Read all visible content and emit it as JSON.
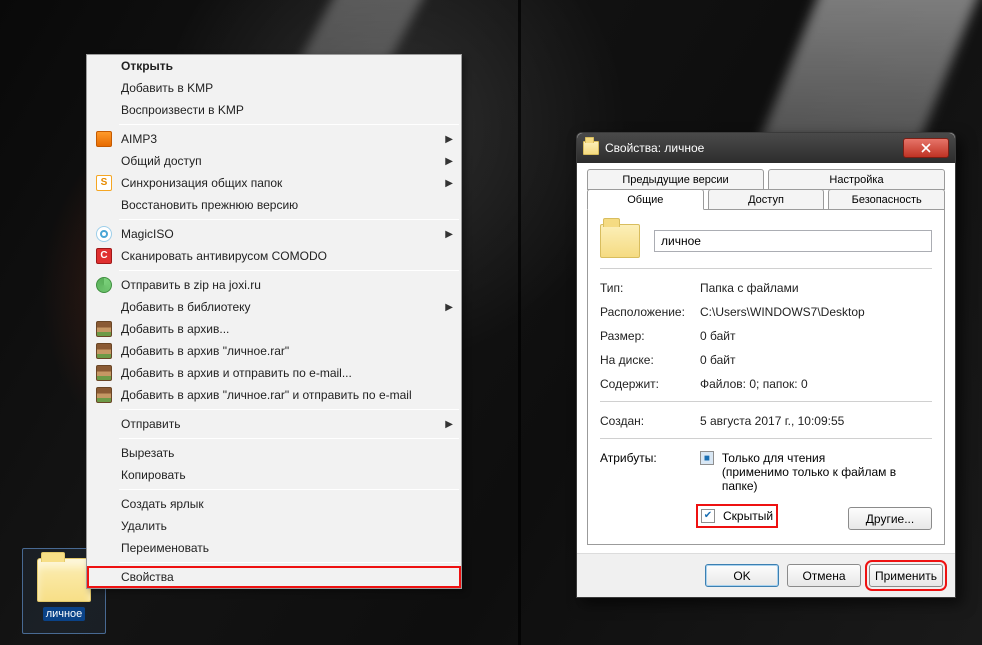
{
  "desktop": {
    "folder_label": "личное"
  },
  "context_menu": {
    "groups": [
      [
        {
          "label": "Открыть",
          "bold": true
        },
        {
          "label": "Добавить в KMP"
        },
        {
          "label": "Воспроизвести в KMP"
        }
      ],
      [
        {
          "label": "AIMP3",
          "icon": "aimp",
          "submenu": true
        },
        {
          "label": "Общий доступ",
          "submenu": true
        },
        {
          "label": "Синхронизация общих папок",
          "icon": "sync",
          "submenu": true
        },
        {
          "label": "Восстановить прежнюю версию"
        }
      ],
      [
        {
          "label": "MagicISO",
          "icon": "magic",
          "submenu": true
        },
        {
          "label": "Сканировать антивирусом COMODO",
          "icon": "comodo"
        }
      ],
      [
        {
          "label": "Отправить в zip на joxi.ru",
          "icon": "joxi"
        },
        {
          "label": "Добавить в библиотеку",
          "submenu": true
        },
        {
          "label": "Добавить в архив...",
          "icon": "rar"
        },
        {
          "label": "Добавить в архив \"личное.rar\"",
          "icon": "rar"
        },
        {
          "label": "Добавить в архив и отправить по e-mail...",
          "icon": "rar"
        },
        {
          "label": "Добавить в архив \"личное.rar\" и отправить по e-mail",
          "icon": "rar"
        }
      ],
      [
        {
          "label": "Отправить",
          "submenu": true
        }
      ],
      [
        {
          "label": "Вырезать"
        },
        {
          "label": "Копировать"
        }
      ],
      [
        {
          "label": "Создать ярлык"
        },
        {
          "label": "Удалить"
        },
        {
          "label": "Переименовать"
        }
      ],
      [
        {
          "label": "Свойства",
          "highlight": true
        }
      ]
    ]
  },
  "dialog": {
    "title": "Свойства: личное",
    "tabs_row1": [
      "Предыдущие версии",
      "Настройка"
    ],
    "tabs_row2": [
      "Общие",
      "Доступ",
      "Безопасность"
    ],
    "active_tab": "Общие",
    "folder_name": "личное",
    "rows": {
      "type_label": "Тип:",
      "type_value": "Папка с файлами",
      "location_label": "Расположение:",
      "location_value": "C:\\Users\\WINDOWS7\\Desktop",
      "size_label": "Размер:",
      "size_value": "0 байт",
      "ondisk_label": "На диске:",
      "ondisk_value": "0 байт",
      "contains_label": "Содержит:",
      "contains_value": "Файлов: 0; папок: 0",
      "created_label": "Создан:",
      "created_value": "5 августа 2017 г., 10:09:55",
      "attr_label": "Атрибуты:",
      "readonly_label": "Только для чтения",
      "readonly_sub": "(применимо только к файлам в папке)",
      "hidden_label": "Скрытый",
      "other_btn": "Другие..."
    },
    "buttons": {
      "ok": "OK",
      "cancel": "Отмена",
      "apply": "Применить"
    }
  }
}
